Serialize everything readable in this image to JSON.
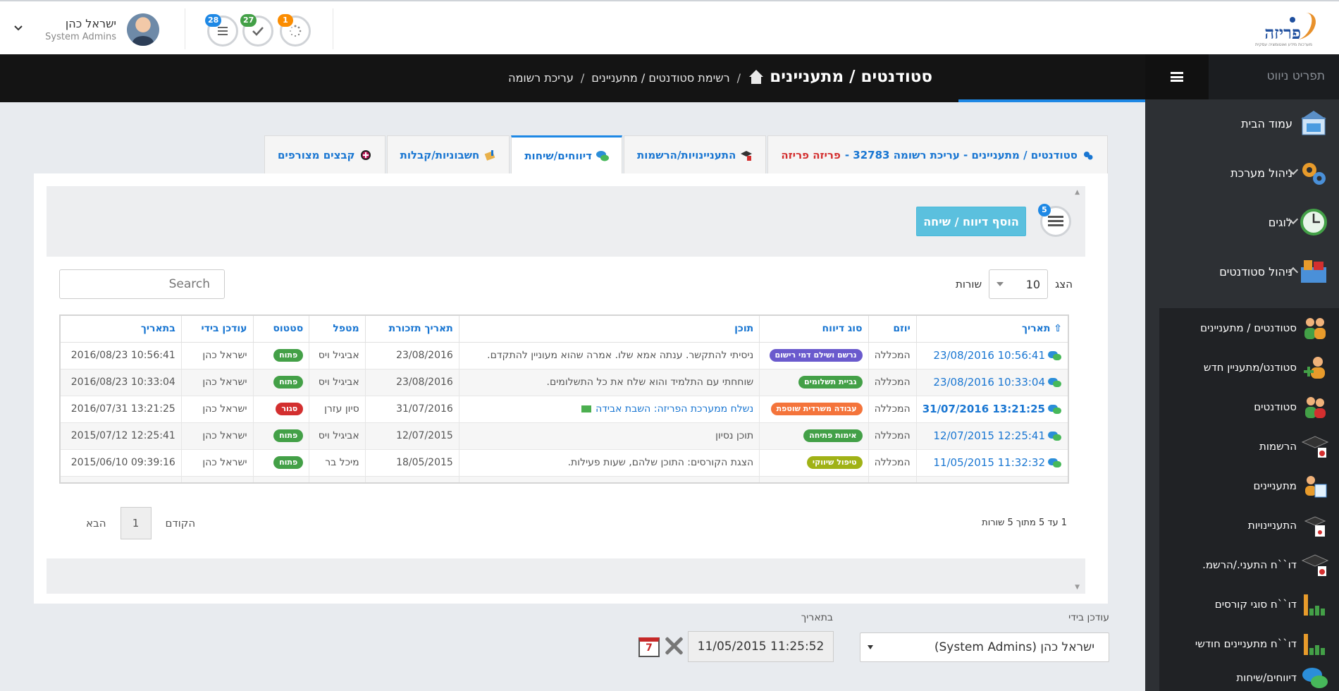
{
  "header": {
    "logo_text": "פריזה",
    "logo_tagline": "מערכות מידע ואוטומציה עסקית",
    "notifications": [
      {
        "count": "28",
        "icon": "list-icon",
        "color": "#1e88e5"
      },
      {
        "count": "27",
        "icon": "check-icon",
        "color": "#43a047"
      },
      {
        "count": "1",
        "icon": "spinner-icon",
        "color": "#fb8c00"
      }
    ],
    "user_name": "ישראל כהן",
    "user_role": "System Admins"
  },
  "titlebar": {
    "page_title": "סטודנטים / מתעניינים",
    "breadcrumb": [
      "רשימת סטודנטים / מתעניינים",
      "עריכת רשומה"
    ]
  },
  "sidebar": {
    "title": "תפריט ניווט",
    "items": [
      {
        "label": "עמוד הבית",
        "icon": "home-page-icon"
      },
      {
        "label": "ניהול מערכת",
        "icon": "gears-icon"
      },
      {
        "label": "לוגים",
        "icon": "clock-icon"
      },
      {
        "label": "ניהול סטודנטים",
        "icon": "students-box-icon"
      }
    ],
    "subitems": [
      {
        "label": "סטודנטים / מתעניינים",
        "icon": "people-group-icon"
      },
      {
        "label": "סטודנט/מתעניין חדש",
        "icon": "add-person-icon"
      },
      {
        "label": "סטודנטים",
        "icon": "students-icon"
      },
      {
        "label": "הרשמות",
        "icon": "graduation-cap-icon"
      },
      {
        "label": "מתעניינים",
        "icon": "interested-icon"
      },
      {
        "label": "התעניינויות",
        "icon": "inquiry-icon"
      },
      {
        "label": "דו``ח התעני./הרשמ.",
        "icon": "report-cap-icon"
      },
      {
        "label": "דו``ח סוגי קורסים",
        "icon": "bar-chart-icon"
      },
      {
        "label": "דו``ח מתעניינים חודשי",
        "icon": "bar-chart-icon"
      },
      {
        "label": "דיווחים/שיחות",
        "icon": "chat-icon"
      }
    ]
  },
  "tabs": {
    "record": "סטודנטים / מתעניינים - עריכת רשומה 32783 -",
    "record_brand": "פריזה פריזה",
    "interests": "התעניינויות/הרשמות",
    "reports": "דיווחים/שיחות",
    "invoices": "חשבוניות/קבלות",
    "attachments": "קבצים מצורפים"
  },
  "panel": {
    "add_button": "הוסף דיווח / שיחה",
    "list_badge": "5",
    "show_label": "הצג",
    "rows_label": "שורות",
    "page_length": "10",
    "search_placeholder": "Search",
    "info": "1 עד 5 מתוך 5 שורות",
    "prev": "הקודם",
    "next": "הבא",
    "current_page": "1"
  },
  "table": {
    "headers": [
      "תאריך",
      "יוזם",
      "סוג דיווח",
      "תוכן",
      "תאריך תזכורת",
      "מטפל",
      "סטטוס",
      "עודכן בידי",
      "בתאריך"
    ],
    "rows": [
      {
        "date": "23/08/2016 10:56:41",
        "initiator": "המכללה",
        "type": "נרשם ושילם דמי רישום",
        "type_color": "#6a5acd",
        "content": "ניסיתי להתקשר. ענתה אמא שלו. אמרה שהוא מעוניין להתקדם.",
        "reminder": "23/08/2016",
        "handler": "אביגיל ויס",
        "status": "פתוח",
        "status_color": "#43a047",
        "updated_by": "ישראל כהן",
        "updated_at": "2016/08/23 10:56:41",
        "bold": false,
        "mail": false
      },
      {
        "date": "23/08/2016 10:33:04",
        "initiator": "המכללה",
        "type": "גביית תשלומים",
        "type_color": "#43a047",
        "content": "שוחחתי עם התלמיד והוא שלח את כל התשלומים.",
        "reminder": "23/08/2016",
        "handler": "אביגיל ויס",
        "status": "פתוח",
        "status_color": "#43a047",
        "updated_by": "ישראל כהן",
        "updated_at": "2016/08/23 10:33:04",
        "bold": false,
        "mail": false
      },
      {
        "date": "31/07/2016 13:21:25",
        "initiator": "המכללה",
        "type": "עבודה משרדית שוטפת",
        "type_color": "#f4743b",
        "content": "נשלח ממערכת הפריזה: השבת אבידה",
        "reminder": "31/07/2016",
        "handler": "סיון עזרן",
        "status": "סגור",
        "status_color": "#d32f2f",
        "updated_by": "ישראל כהן",
        "updated_at": "2016/07/31 13:21:25",
        "bold": true,
        "mail": true
      },
      {
        "date": "12/07/2015 12:25:41",
        "initiator": "המכללה",
        "type": "אימות פתיחה",
        "type_color": "#43a047",
        "content": "תוכן נסיון",
        "reminder": "12/07/2015",
        "handler": "אביגיל ויס",
        "status": "פתוח",
        "status_color": "#43a047",
        "updated_by": "ישראל כהן",
        "updated_at": "2015/07/12 12:25:41",
        "bold": false,
        "mail": false
      },
      {
        "date": "11/05/2015 11:32:32",
        "initiator": "המכללה",
        "type": "טיפול שיווקי",
        "type_color": "#a0b216",
        "content": "הצגת הקורסים: התוכן שלהם, שעות פעילות.",
        "reminder": "18/05/2015",
        "handler": "מיכל בר",
        "status": "פתוח",
        "status_color": "#43a047",
        "updated_by": "ישראל כהן",
        "updated_at": "2015/06/10 09:39:16",
        "bold": false,
        "mail": false
      }
    ]
  },
  "form": {
    "updated_by_label": "עודכן בידי",
    "updated_by_value": "ישראל כהן (System Admins)",
    "updated_at_label": "בתאריך",
    "updated_at_value": "11/05/2015 11:25:52",
    "calendar_day": "7"
  },
  "colors": {
    "accent": "#1e88e5",
    "sidebar": "#2d3034",
    "info_button": "#5bc0de"
  }
}
